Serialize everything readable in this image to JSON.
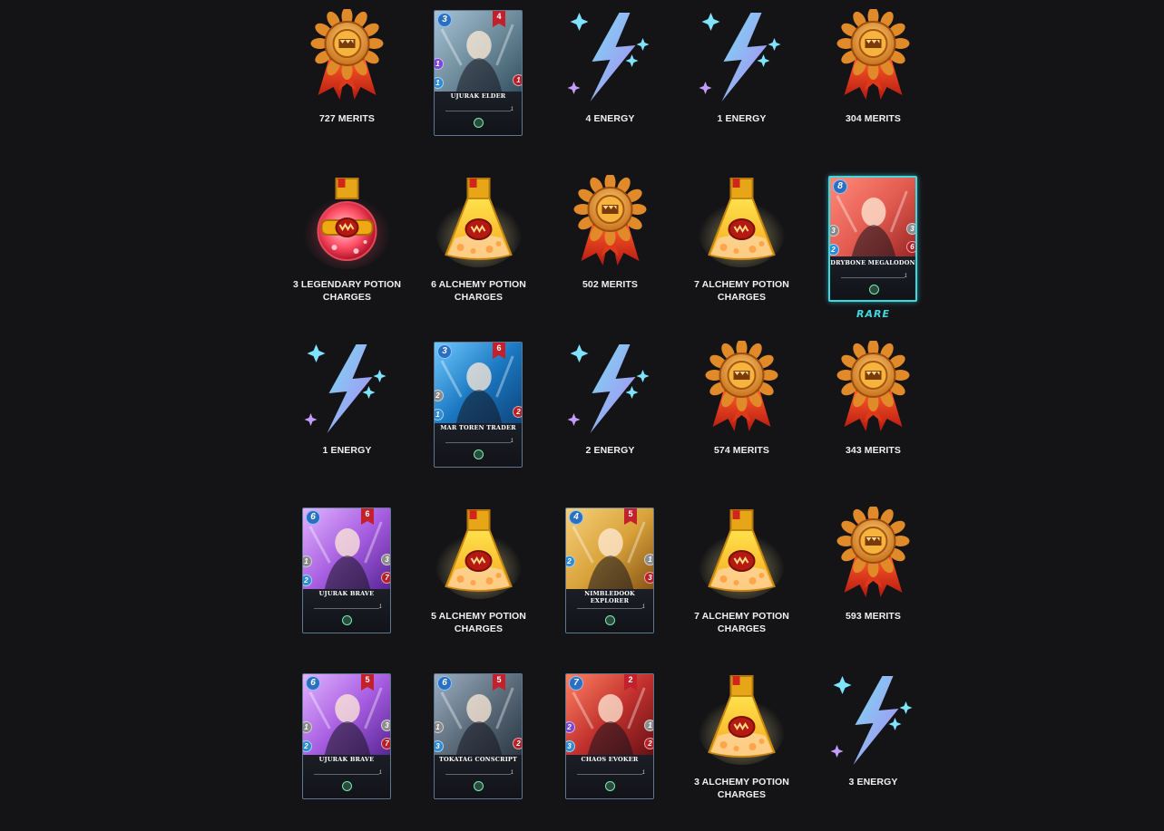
{
  "rewards": [
    {
      "type": "merits",
      "label": "727 MERITS"
    },
    {
      "type": "card",
      "name": "UJURAK ELDER",
      "mana": "3",
      "level": "4",
      "stats": [
        {
          "kind": "magic",
          "value": "1",
          "side": "left"
        },
        {
          "kind": "speed",
          "value": "1",
          "side": "left"
        },
        {
          "kind": "health",
          "value": "1",
          "side": "right"
        }
      ],
      "card_level": "1",
      "palette": "teal"
    },
    {
      "type": "energy",
      "label": "4 ENERGY"
    },
    {
      "type": "energy",
      "label": "1 ENERGY"
    },
    {
      "type": "merits",
      "label": "304 MERITS"
    },
    {
      "type": "legendary_potion",
      "label": "3 LEGENDARY POTION CHARGES"
    },
    {
      "type": "alchemy_potion",
      "label": "6 ALCHEMY POTION CHARGES"
    },
    {
      "type": "merits",
      "label": "502 MERITS"
    },
    {
      "type": "alchemy_potion",
      "label": "7 ALCHEMY POTION CHARGES"
    },
    {
      "type": "card",
      "name": "DRYBONE MEGALODON",
      "mana": "8",
      "level": "",
      "rarity": "RARE",
      "stats": [
        {
          "kind": "melee",
          "value": "3",
          "side": "left"
        },
        {
          "kind": "speed",
          "value": "2",
          "side": "left"
        },
        {
          "kind": "armor",
          "value": "3",
          "side": "right"
        },
        {
          "kind": "health",
          "value": "6",
          "side": "right"
        }
      ],
      "card_level": "1",
      "palette": "red"
    },
    {
      "type": "energy",
      "label": "1 ENERGY"
    },
    {
      "type": "card",
      "name": "MAR TOREN TRADER",
      "mana": "3",
      "level": "6",
      "stats": [
        {
          "kind": "melee",
          "value": "2",
          "side": "left"
        },
        {
          "kind": "speed",
          "value": "1",
          "side": "left"
        },
        {
          "kind": "health",
          "value": "2",
          "side": "right"
        }
      ],
      "card_level": "1",
      "palette": "blue"
    },
    {
      "type": "energy",
      "label": "2 ENERGY"
    },
    {
      "type": "merits",
      "label": "574 MERITS"
    },
    {
      "type": "merits",
      "label": "343 MERITS"
    },
    {
      "type": "card",
      "name": "UJURAK BRAVE",
      "mana": "6",
      "level": "6",
      "stats": [
        {
          "kind": "melee",
          "value": "1",
          "side": "left"
        },
        {
          "kind": "speed",
          "value": "2",
          "side": "left"
        },
        {
          "kind": "armor",
          "value": "3",
          "side": "right"
        },
        {
          "kind": "health",
          "value": "7",
          "side": "right"
        }
      ],
      "card_level": "1",
      "palette": "purple"
    },
    {
      "type": "alchemy_potion",
      "label": "5 ALCHEMY POTION CHARGES"
    },
    {
      "type": "card",
      "name": "NIMBLEDOOK EXPLORER",
      "mana": "4",
      "level": "5",
      "stats": [
        {
          "kind": "speed",
          "value": "2",
          "side": "left"
        },
        {
          "kind": "armor",
          "value": "1",
          "side": "right"
        },
        {
          "kind": "health",
          "value": "3",
          "side": "right"
        }
      ],
      "card_level": "1",
      "palette": "gold"
    },
    {
      "type": "alchemy_potion",
      "label": "7 ALCHEMY POTION CHARGES"
    },
    {
      "type": "merits",
      "label": "593 MERITS"
    },
    {
      "type": "card",
      "name": "UJURAK BRAVE",
      "mana": "6",
      "level": "5",
      "stats": [
        {
          "kind": "melee",
          "value": "1",
          "side": "left"
        },
        {
          "kind": "speed",
          "value": "2",
          "side": "left"
        },
        {
          "kind": "armor",
          "value": "3",
          "side": "right"
        },
        {
          "kind": "health",
          "value": "7",
          "side": "right"
        }
      ],
      "card_level": "1",
      "palette": "purple"
    },
    {
      "type": "card",
      "name": "TOKATAG CONSCRIPT",
      "mana": "6",
      "level": "5",
      "stats": [
        {
          "kind": "melee",
          "value": "1",
          "side": "left"
        },
        {
          "kind": "speed",
          "value": "3",
          "side": "left"
        },
        {
          "kind": "health",
          "value": "2",
          "side": "right"
        }
      ],
      "card_level": "1",
      "palette": "slate"
    },
    {
      "type": "card",
      "name": "CHAOS EVOKER",
      "mana": "7",
      "level": "2",
      "stats": [
        {
          "kind": "magic",
          "value": "2",
          "side": "left"
        },
        {
          "kind": "speed",
          "value": "3",
          "side": "left"
        },
        {
          "kind": "armor",
          "value": "1",
          "side": "right"
        },
        {
          "kind": "health",
          "value": "2",
          "side": "right"
        }
      ],
      "card_level": "1",
      "palette": "crimson"
    },
    {
      "type": "alchemy_potion",
      "label": "3 ALCHEMY POTION CHARGES"
    },
    {
      "type": "energy",
      "label": "3 ENERGY"
    }
  ],
  "colors": {
    "background": "#141417",
    "rare": "#3fd9e0",
    "label": "#f0f0f0"
  }
}
